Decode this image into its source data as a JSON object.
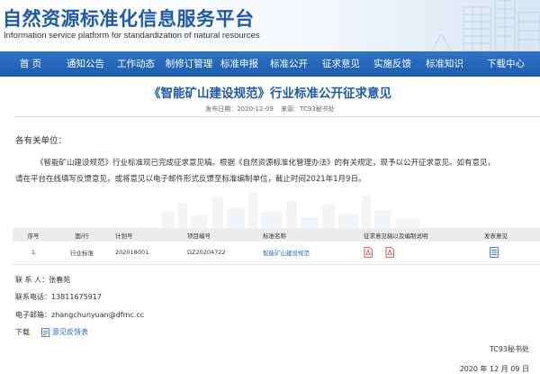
{
  "header": {
    "title_cn": "自然资源标准化信息服务平台",
    "title_en": "Information service platform for standardization of natural resources"
  },
  "nav": [
    {
      "label": "首 页"
    },
    {
      "label": "通知公告"
    },
    {
      "label": "工作动态"
    },
    {
      "label": "制修订管理"
    },
    {
      "label": "标准申报"
    },
    {
      "label": "标准公开"
    },
    {
      "label": "征求意见"
    },
    {
      "label": "实施反馈"
    },
    {
      "label": "标准知识"
    },
    {
      "label": "下载中心"
    }
  ],
  "article": {
    "title": "《智能矿山建设规范》行业标准公开征求意见",
    "date_label": "发布日期：2020-12-09",
    "source_label": "来源：TC93秘书处",
    "salutation": "各有关单位：",
    "para1": "《智能矿山建设规范》行业标准现已完成征求意见稿。根据《自然资源标准化管理办法》的有关规定，现予以公开征求意见。如有意见，",
    "para2": "请在平台在线填写反馈意见，或将意见以电子邮件形式反馈至标准编制单位，截止时间2021年1月9日。"
  },
  "table": {
    "headers": [
      "序号",
      "国/行",
      "计划号",
      "项目编号",
      "标准名称",
      "征求意见稿以及编制说明",
      "发表意见"
    ],
    "rows": [
      {
        "no": "1",
        "type": "行业标准",
        "plan": "202018001",
        "project": "DZ20204722",
        "name": "智能矿山建设规范"
      }
    ]
  },
  "contact": {
    "person_label": "联 系 人：",
    "person": "张春苑",
    "phone_label": "联系电话：",
    "phone": "13811675917",
    "email_label": "电子邮箱：",
    "email": "zhangchunyuan@dfmc.cc"
  },
  "download": {
    "label": "下载",
    "link": "意见反馈表"
  },
  "signature": {
    "org": "TC93秘书处",
    "date": "2020 年 12 月 09 日"
  },
  "colors": {
    "brand_blue": "#1d5aa8",
    "nav_blue": "#1b5cae",
    "link_blue": "#2a6ac4",
    "pdf_red": "#d9342b"
  }
}
